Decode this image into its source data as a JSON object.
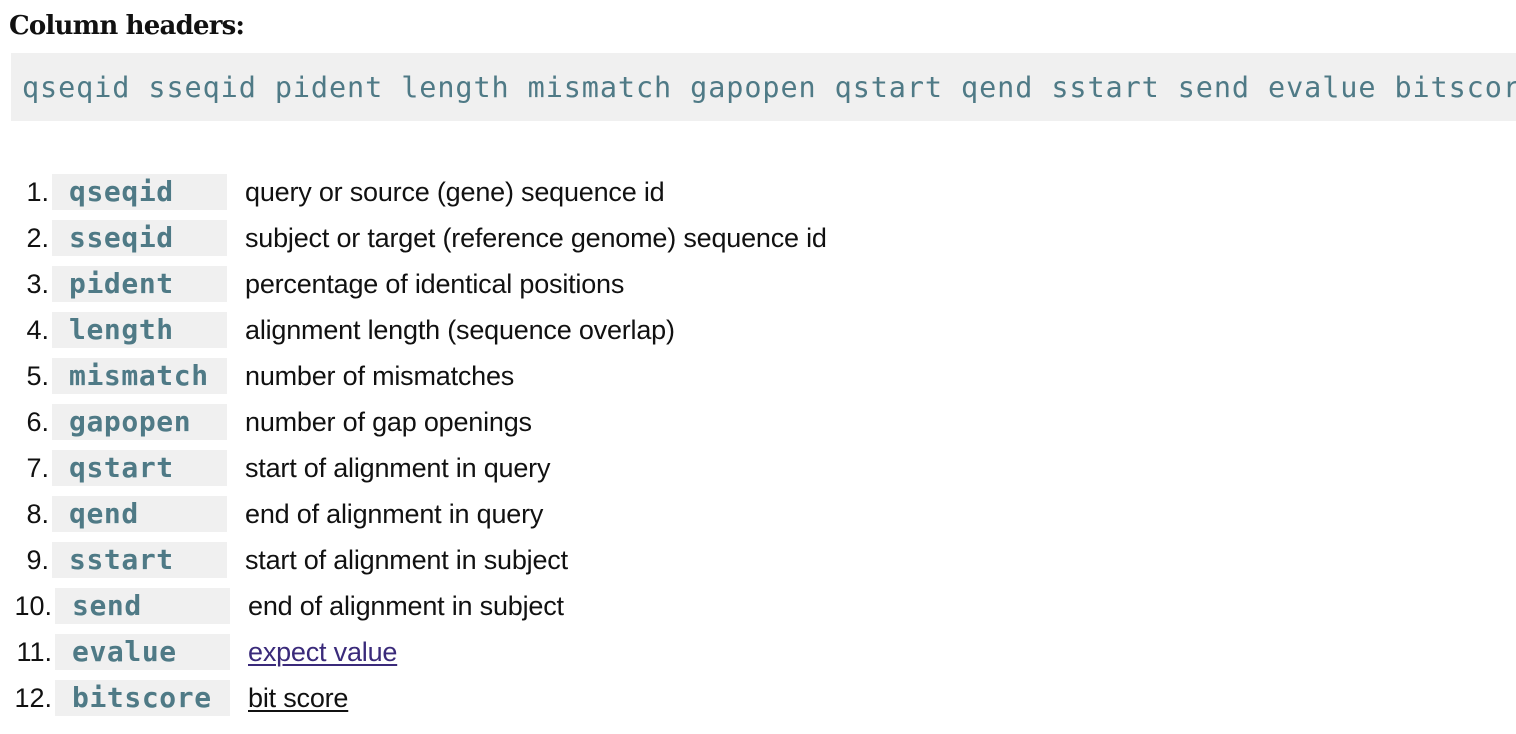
{
  "heading": "Column headers:",
  "code_line": "qseqid sseqid pident length mismatch gapopen qstart qend sstart send evalue bitscore",
  "columns": [
    {
      "number": "1.",
      "code": "qseqid",
      "description": "query or source (gene) sequence id"
    },
    {
      "number": "2.",
      "code": "sseqid",
      "description": "subject or target (reference genome) sequence id"
    },
    {
      "number": "3.",
      "code": "pident",
      "description": "percentage of identical positions"
    },
    {
      "number": "4.",
      "code": "length",
      "description": "alignment length (sequence overlap)"
    },
    {
      "number": "5.",
      "code": "mismatch",
      "description": "number of mismatches"
    },
    {
      "number": "6.",
      "code": "gapopen",
      "description": "number of gap openings"
    },
    {
      "number": "7.",
      "code": "qstart",
      "description": "start of alignment in query"
    },
    {
      "number": "8.",
      "code": "qend",
      "description": "end of alignment in query"
    },
    {
      "number": "9.",
      "code": "sstart",
      "description": "start of alignment in subject"
    },
    {
      "number": "10.",
      "code": "send",
      "description": "end of alignment in subject"
    },
    {
      "number": "11.",
      "code": "evalue",
      "description": "expect value"
    },
    {
      "number": "12.",
      "code": "bitscore",
      "description": "bit score"
    }
  ],
  "colors": {
    "code_text": "#4f7a86",
    "code_background": "#f0f0f0",
    "visited_link": "#3a2a7a",
    "body_text": "#111111"
  }
}
